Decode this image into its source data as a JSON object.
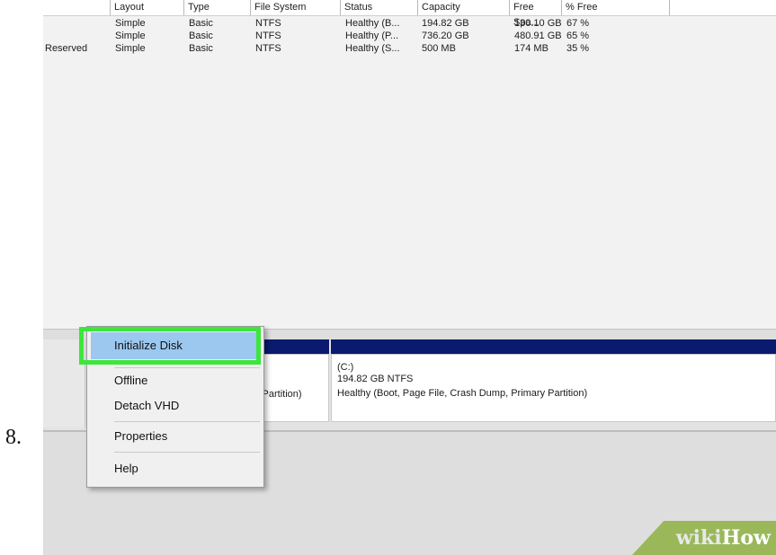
{
  "step": "8.",
  "volume_list": {
    "columns": [
      "Layout",
      "Type",
      "File System",
      "Status",
      "Capacity",
      "Free Spa...",
      "% Free"
    ],
    "rows": [
      {
        "volume": "",
        "layout": "Simple",
        "type": "Basic",
        "fs": "NTFS",
        "status": "Healthy (B...",
        "capacity": "194.82 GB",
        "free": "130.10 GB",
        "pct": "67 %"
      },
      {
        "volume": "",
        "layout": "Simple",
        "type": "Basic",
        "fs": "NTFS",
        "status": "Healthy (P...",
        "capacity": "736.20 GB",
        "free": "480.91 GB",
        "pct": "65 %"
      },
      {
        "volume": "Reserved",
        "layout": "Simple",
        "type": "Basic",
        "fs": "NTFS",
        "status": "Healthy (S...",
        "capacity": "500 MB",
        "free": "174 MB",
        "pct": "35 %"
      }
    ]
  },
  "disk": {
    "partition_left_label": "y Partition)",
    "volume_c": {
      "name": "(C:)",
      "size": "194.82 GB NTFS",
      "status": "Healthy (Boot, Page File, Crash Dump, Primary Partition)"
    }
  },
  "context_menu": {
    "initialize": "Initialize Disk",
    "offline": "Offline",
    "detach": "Detach VHD",
    "properties": "Properties",
    "help": "Help"
  },
  "watermark": {
    "part1": "wiki",
    "part2": "How",
    "color": "#9ab85a"
  },
  "colors": {
    "highlight": "#3ce63c",
    "volume_bar": "#0a1a6e",
    "menu_selection": "#9cc7ee"
  }
}
